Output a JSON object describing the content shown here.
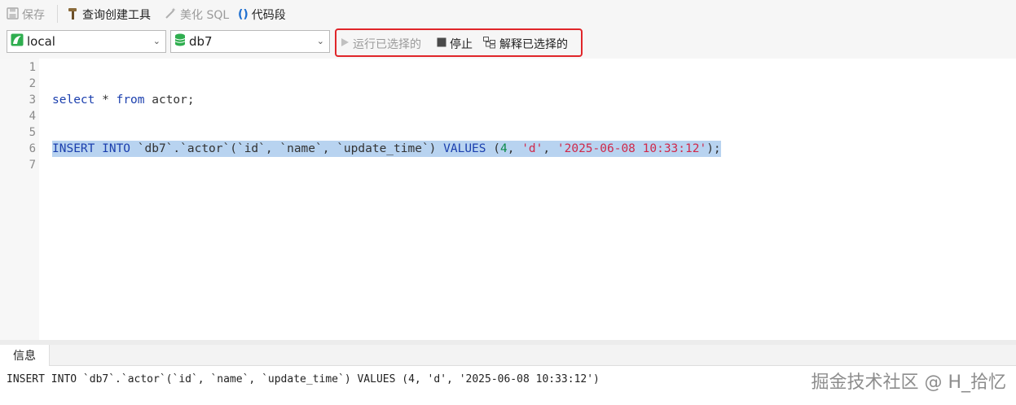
{
  "toolbar": {
    "save_label": "保存",
    "query_builder_label": "查询创建工具",
    "beautify_label": "美化 SQL",
    "snippet_label": "代码段"
  },
  "connection": {
    "value": "local"
  },
  "database": {
    "value": "db7"
  },
  "actions": {
    "run_selected_label": "运行已选择的",
    "stop_label": "停止",
    "explain_selected_label": "解释已选择的"
  },
  "editor": {
    "line_numbers": [
      "1",
      "2",
      "3",
      "4",
      "5",
      "6",
      "7"
    ],
    "line3": {
      "kw1": "select",
      "mid": " * ",
      "kw2": "from",
      "rest": " actor;"
    },
    "line6": {
      "kw1": "INSERT INTO",
      "p1": " `db7`.`actor`(`id`, `name`, `update_time`) ",
      "kw2": "VALUES",
      "p2": " (",
      "num": "4",
      "p3": ", ",
      "s1": "'d'",
      "p4": ", ",
      "s2": "'2025-06-08 10:33:12'",
      "p5": ");"
    }
  },
  "panel": {
    "tab_info": "信息",
    "message": "INSERT INTO `db7`.`actor`(`id`, `name`, `update_time`) VALUES (4, 'd', '2025-06-08 10:33:12')"
  },
  "watermark": "掘金技术社区 @ H_拾忆",
  "colors": {
    "highlight_box": "#e0262a",
    "keyword": "#1b3fae",
    "string": "#d0294a",
    "number": "#0c8a4a",
    "selection": "#b8d3f0"
  }
}
